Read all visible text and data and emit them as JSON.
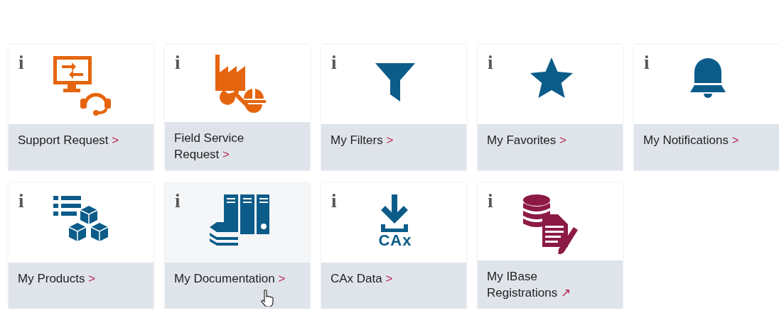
{
  "tiles": [
    {
      "info": "i",
      "kind": "support",
      "color": "#e5650f",
      "label": "Support Request",
      "link_mark": ">",
      "hovered": false
    },
    {
      "info": "i",
      "kind": "field-service",
      "color": "#e5650f",
      "label": "Field Service Request",
      "link_mark": ">",
      "hovered": false
    },
    {
      "info": "i",
      "kind": "filter",
      "color": "#0c5c89",
      "label": "My Filters",
      "link_mark": ">",
      "hovered": false
    },
    {
      "info": "i",
      "kind": "star",
      "color": "#0c5c89",
      "label": "My Favorites",
      "link_mark": ">",
      "hovered": false
    },
    {
      "info": "i",
      "kind": "bell",
      "color": "#0c5c89",
      "label": "My Notifications",
      "link_mark": ">",
      "hovered": false
    },
    {
      "info": "i",
      "kind": "products",
      "color": "#0c5c89",
      "label": "My Products",
      "link_mark": ">",
      "hovered": false
    },
    {
      "info": "i",
      "kind": "documentation",
      "color": "#0c5c89",
      "label": "My Documentation",
      "link_mark": ">",
      "hovered": true
    },
    {
      "info": "i",
      "kind": "download",
      "icon_text": "CAx",
      "color": "#0c5c89",
      "label": "CAx Data",
      "link_mark": ">",
      "hovered": false
    },
    {
      "info": "i",
      "kind": "database-document",
      "color": "#8c1a45",
      "label": "My IBase Registrations",
      "link_mark": "↗",
      "hovered": false
    }
  ]
}
